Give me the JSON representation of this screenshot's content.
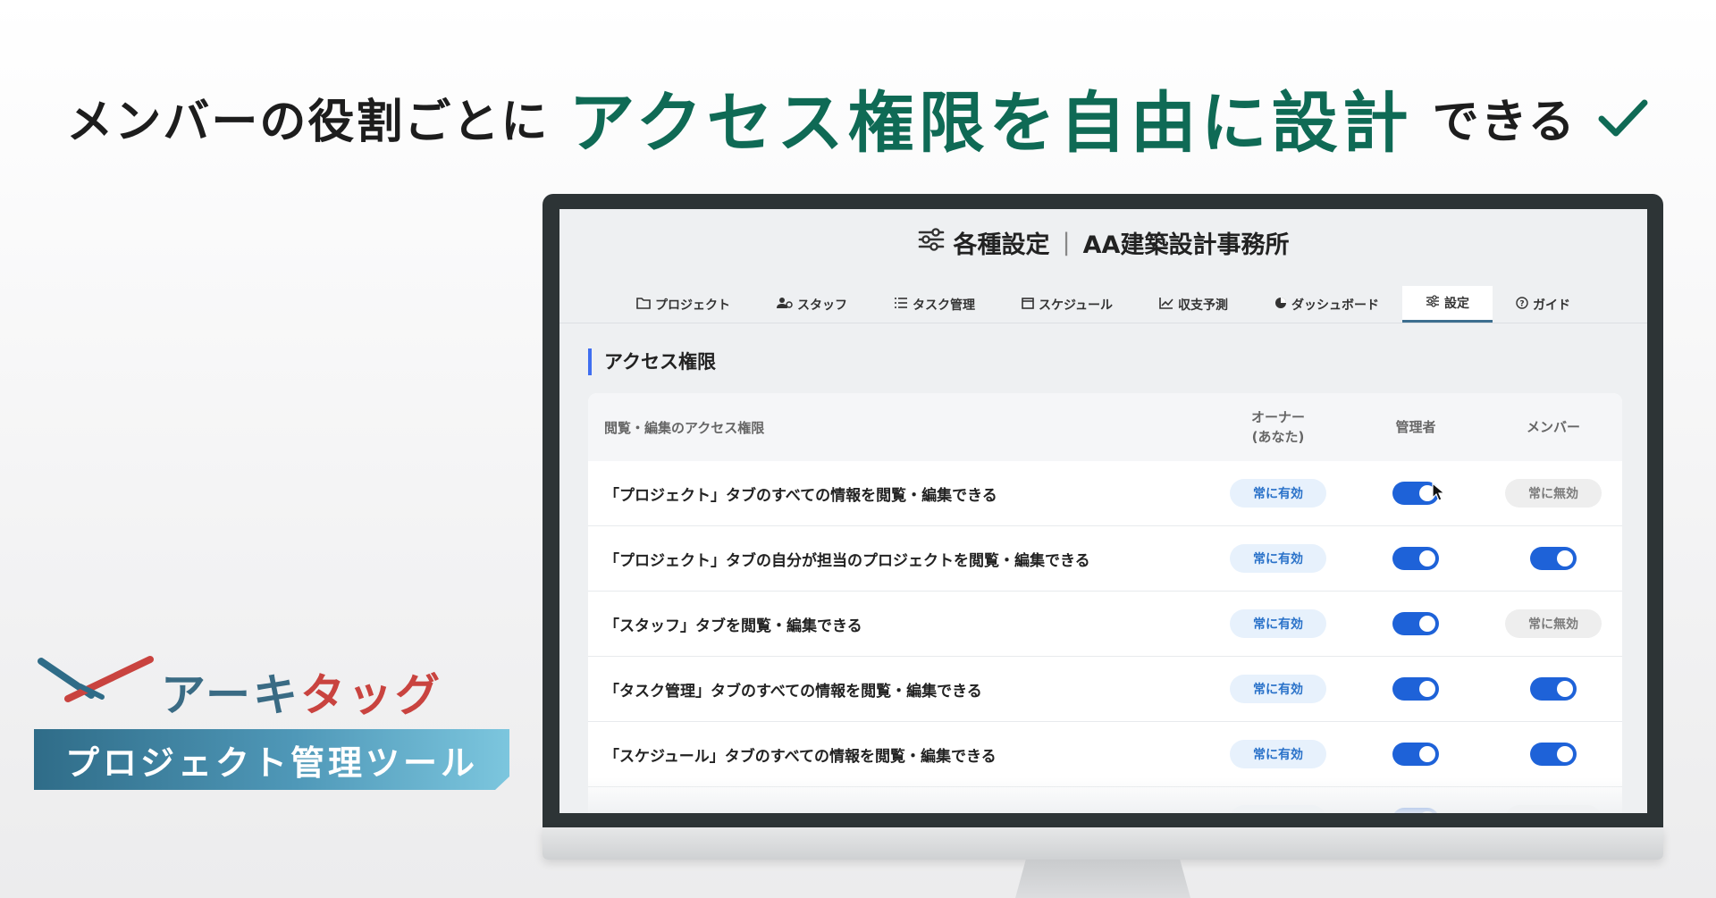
{
  "headline": {
    "part1": "メンバーの役割ごとに",
    "accent": "アクセス権限を自由に設計",
    "part2": "できる",
    "accent_color": "#0f6a55",
    "check_icon": "check-icon"
  },
  "brand": {
    "name_part1": "アーキ",
    "name_part2": "タッグ",
    "tagline": "プロジェクト管理ツール",
    "colors": {
      "blue": "#3a6b84",
      "red": "#c9433f"
    }
  },
  "app": {
    "title": "各種設定",
    "separator": "|",
    "org": "AA建築設計事務所",
    "title_icon": "sliders-icon"
  },
  "tabs": [
    {
      "label": "プロジェクト",
      "icon": "folder-icon",
      "active": false
    },
    {
      "label": "スタッフ",
      "icon": "users-icon",
      "active": false
    },
    {
      "label": "タスク管理",
      "icon": "list-icon",
      "active": false
    },
    {
      "label": "スケジュール",
      "icon": "calendar-icon",
      "active": false
    },
    {
      "label": "収支予測",
      "icon": "chart-line-icon",
      "active": false
    },
    {
      "label": "ダッシュボード",
      "icon": "pie-chart-icon",
      "active": false
    },
    {
      "label": "設定",
      "icon": "sliders-icon",
      "active": true
    },
    {
      "label": "ガイド",
      "icon": "help-circle-icon",
      "active": false
    }
  ],
  "section": {
    "title": "アクセス権限"
  },
  "table": {
    "header": {
      "desc": "閲覧・編集のアクセス権限",
      "owner_line1": "オーナー",
      "owner_line2": "(あなた)",
      "admin": "管理者",
      "member": "メンバー"
    },
    "rows": [
      {
        "label": "「プロジェクト」タブのすべての情報を閲覧・編集できる",
        "owner": "常に有効",
        "admin": "on",
        "member": "常に無効"
      },
      {
        "label": "「プロジェクト」タブの自分が担当のプロジェクトを閲覧・編集できる",
        "owner": "常に有効",
        "admin": "on",
        "member": "on"
      },
      {
        "label": "「スタッフ」タブを閲覧・編集できる",
        "owner": "常に有効",
        "admin": "on",
        "member": "常に無効"
      },
      {
        "label": "「タスク管理」タブのすべての情報を閲覧・編集できる",
        "owner": "常に有効",
        "admin": "on",
        "member": "on"
      },
      {
        "label": "「スケジュール」タブのすべての情報を閲覧・編集できる",
        "owner": "常に有効",
        "admin": "on",
        "member": "on"
      }
    ],
    "toggle_color": "#1e62d8"
  }
}
